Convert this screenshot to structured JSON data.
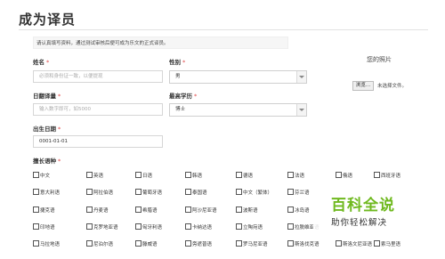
{
  "page": {
    "title": "成为译员",
    "intro": "请认真填写资料，通过测试审核后便可成为乐文的正式译员。"
  },
  "form": {
    "name": {
      "label": "姓名",
      "required": "*",
      "placeholder": "必须和身份证一致，以便提现"
    },
    "gender": {
      "label": "性别",
      "required": "*",
      "value": "男"
    },
    "daily_volume": {
      "label": "日翻译量",
      "required": "*",
      "placeholder": "输入数字即可，如5000"
    },
    "education": {
      "label": "最高学历",
      "required": "*",
      "value": "博士"
    },
    "birthdate": {
      "label": "出生日期",
      "required": "*",
      "value": "0001-01-01"
    },
    "languages_label": {
      "label": "擅长语种",
      "required": "*"
    }
  },
  "photo": {
    "label": "您的照片",
    "button": "浏览...",
    "status": "未选择文件。"
  },
  "languages": [
    [
      "中文",
      "英语",
      "日语",
      "韩语",
      "德语",
      "法语",
      "俄语",
      "西班牙语"
    ],
    [
      "意大利语",
      "阿拉伯语",
      "葡萄牙语",
      "泰国语",
      "中文（繁体）",
      "芬兰语",
      "",
      ""
    ],
    [
      "捷克语",
      "丹麦语",
      "希腊语",
      "阿沙尼亚语",
      "波斯语",
      "冰岛语",
      "",
      ""
    ],
    [
      "印地语",
      "克罗地亚语",
      "匈牙利语",
      "卡纳达语",
      "立陶宛语",
      "拉脱维亚语",
      "",
      ""
    ],
    [
      "马拉地语",
      "尼泊尔语",
      "滕威语",
      "旁遮普语",
      "罗马尼亚语",
      "斯洛伐克语",
      "斯洛文尼亚语",
      "索马里语"
    ]
  ],
  "watermark": {
    "main": "百科全说",
    "sub": "助你轻松解决"
  }
}
